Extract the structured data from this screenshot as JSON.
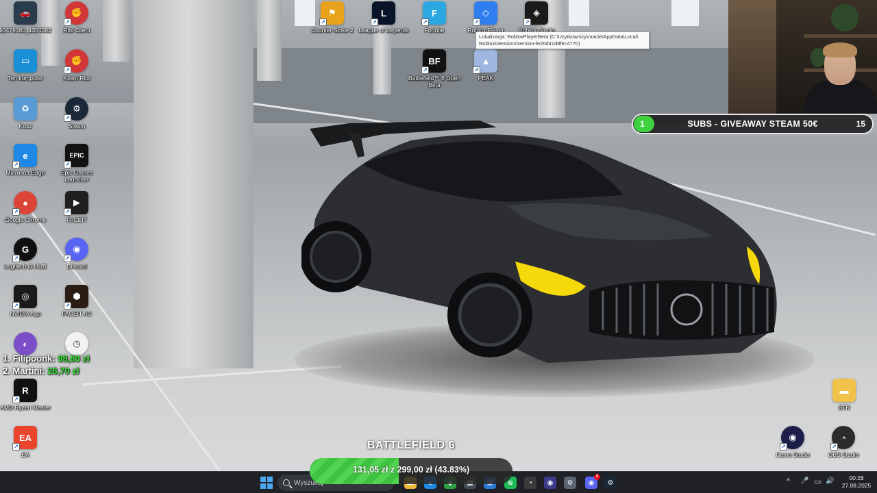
{
  "desktop_icons": [
    {
      "id": "hashid",
      "label": "93479480_1354382",
      "color": "#2a3b4c",
      "icon": "screenshot-icon",
      "glyph": "🚗",
      "shortcut": false
    },
    {
      "id": "riot-client",
      "label": "Riot Client",
      "color": "#d13639",
      "icon": "riot-fist-icon",
      "glyph": "✊",
      "shortcut": true
    },
    {
      "id": "ten-komputer",
      "label": "Ten komputer",
      "color": "#1b8fd6",
      "icon": "monitor-icon",
      "glyph": "▭",
      "shortcut": false
    },
    {
      "id": "klient-riot",
      "label": "Klient Riot",
      "color": "#d13639",
      "icon": "riot-fist-icon",
      "glyph": "✊",
      "shortcut": true
    },
    {
      "id": "kosz",
      "label": "Kosz",
      "color": "#5a9bd5",
      "icon": "recycle-bin-icon",
      "glyph": "♻",
      "shortcut": false
    },
    {
      "id": "steam",
      "label": "Steam",
      "color": "#1b2838",
      "icon": "steam-icon",
      "glyph": "⚙",
      "shortcut": true
    },
    {
      "id": "microsoft-edge",
      "label": "Microsoft Edge",
      "color": "#1e88e5",
      "icon": "edge-icon",
      "glyph": "e",
      "shortcut": true
    },
    {
      "id": "epic-games",
      "label": "Epic Games Launcher",
      "color": "#121212",
      "icon": "epic-games-icon",
      "glyph": "EPIC",
      "shortcut": true
    },
    {
      "id": "google-chrome",
      "label": "Google Chrome",
      "color": "#db4437",
      "icon": "chrome-icon",
      "glyph": "●",
      "shortcut": true
    },
    {
      "id": "faceit",
      "label": "FACEIT",
      "color": "#1f1f1f",
      "icon": "faceit-icon",
      "glyph": "▶",
      "shortcut": true
    },
    {
      "id": "logitech",
      "label": "Logitech G HUB",
      "color": "#111111",
      "icon": "logitech-icon",
      "glyph": "G",
      "shortcut": true
    },
    {
      "id": "discord",
      "label": "Discord",
      "color": "#5865f2",
      "icon": "discord-icon",
      "glyph": "◉",
      "shortcut": true
    },
    {
      "id": "nvidia",
      "label": "NVIDIA App",
      "color": "#1a1a1a",
      "icon": "nvidia-icon",
      "glyph": "◎",
      "shortcut": true
    },
    {
      "id": "faceit-ac",
      "label": "FACEIT AC",
      "color": "#2a1c12",
      "icon": "faceit-ac-icon",
      "glyph": "⬢",
      "shortcut": true
    },
    {
      "id": "app-purple",
      "label": "",
      "color": "#7b4fc9",
      "icon": "purple-app-icon",
      "glyph": "◐",
      "shortcut": false
    },
    {
      "id": "app-clock",
      "label": "",
      "color": "#f2f2f2",
      "icon": "stopwatch-icon",
      "glyph": "◷",
      "shortcut": false
    },
    {
      "id": "ryzen",
      "label": "AMD Ryzen Master",
      "color": "#111111",
      "icon": "ryzen-icon",
      "glyph": "R",
      "shortcut": true
    },
    {
      "id": "ea",
      "label": "EA",
      "color": "#e8452c",
      "icon": "ea-icon",
      "glyph": "EA",
      "shortcut": true
    },
    {
      "id": "cs2",
      "label": "Counter-Strike 2",
      "color": "#e8a21c",
      "icon": "cs2-icon",
      "glyph": "⚑",
      "shortcut": true
    },
    {
      "id": "lol",
      "label": "League of Legends",
      "color": "#0a1428",
      "icon": "lol-icon",
      "glyph": "L",
      "shortcut": true
    },
    {
      "id": "fortnite",
      "label": "Fortnite",
      "color": "#2aa7e0",
      "icon": "fortnite-icon",
      "glyph": "F",
      "shortcut": true
    },
    {
      "id": "roblox-player",
      "label": "Roblox Player",
      "color": "#2f7ef0",
      "icon": "roblox-icon",
      "glyph": "◇",
      "shortcut": true
    },
    {
      "id": "roblox-studio",
      "label": "Roblox Studio",
      "color": "#1a1a1a",
      "icon": "roblox-studio-icon",
      "glyph": "◈",
      "shortcut": true
    },
    {
      "id": "battlefield",
      "label": "Battlefield™ 6 Open Beta",
      "color": "#111111",
      "icon": "battlefield-icon",
      "glyph": "BF",
      "shortcut": true
    },
    {
      "id": "peak",
      "label": "PEAK",
      "color": "#9fb7e0",
      "icon": "peak-icon",
      "glyph": "▲",
      "shortcut": true
    },
    {
      "id": "str-folder",
      "label": "STR",
      "color": "#f0c24a",
      "icon": "folder-icon",
      "glyph": "▬",
      "shortcut": false
    },
    {
      "id": "camo",
      "label": "Camo Studio",
      "color": "#1d1f4a",
      "icon": "camo-icon",
      "glyph": "◉",
      "shortcut": true
    },
    {
      "id": "obs",
      "label": "OBS Studio",
      "color": "#2b2b2b",
      "icon": "obs-icon",
      "glyph": "◔",
      "shortcut": true
    }
  ],
  "tooltip": {
    "lines": [
      "Lokalizacja: RobloxPlayerBeta (C:\\Uzytkownicy\\macie\\AppData\\Local\\",
      "Roblox\\Versions\\version-fe20d41d8fec4770)"
    ]
  },
  "subs_goal": {
    "current": "1",
    "title": "SUBS - GIVEAWAY STEAM 50€",
    "goal": "15",
    "progress": 0.0667,
    "fill_color": "#3fd23f"
  },
  "donors": [
    {
      "rank": "1.",
      "name": "Filipoonk:",
      "amount": "98,80 zł"
    },
    {
      "rank": "2.",
      "name": "Martini:",
      "amount": "28,70 zł"
    }
  ],
  "donation_goal": {
    "title": "BATTLEFIELD 6",
    "text": "131,05 zł z 299,00 zł (43.83%)",
    "progress": 0.4383,
    "fill_color": "#46c846"
  },
  "taskbar": {
    "search_placeholder": "Wyszukaj",
    "apps": [
      {
        "id": "explorer",
        "icon": "folder-icon",
        "color": "#f0b93a",
        "glyph": "▬"
      },
      {
        "id": "edge",
        "icon": "edge-icon",
        "color": "#1e88e5",
        "glyph": "e"
      },
      {
        "id": "app-green",
        "icon": "app-green-icon",
        "color": "#2ea043",
        "glyph": "◆"
      },
      {
        "id": "app-tablet",
        "icon": "tablet-icon",
        "color": "#444a54",
        "glyph": "▦"
      },
      {
        "id": "store",
        "icon": "store-icon",
        "color": "#2b79d6",
        "glyph": "⊞"
      },
      {
        "id": "spotify",
        "icon": "spotify-icon",
        "color": "#1db954",
        "glyph": "≋"
      },
      {
        "id": "obs",
        "icon": "obs-icon",
        "color": "#3a3a3a",
        "glyph": "◔"
      },
      {
        "id": "camo",
        "icon": "camo-icon",
        "color": "#3e3a8c",
        "glyph": "◉"
      },
      {
        "id": "settings",
        "icon": "gear-icon",
        "color": "#5b6470",
        "glyph": "⚙"
      },
      {
        "id": "discord",
        "icon": "discord-icon",
        "color": "#5865f2",
        "glyph": "◉",
        "badge": "2"
      },
      {
        "id": "steam",
        "icon": "steam-icon",
        "color": "#1b2838",
        "glyph": "⚙"
      }
    ],
    "tray": {
      "chevron": "^",
      "mic": "🎤",
      "display": "▭",
      "volume": "🔊"
    },
    "time": "00:28",
    "date": "27.08.2025"
  }
}
